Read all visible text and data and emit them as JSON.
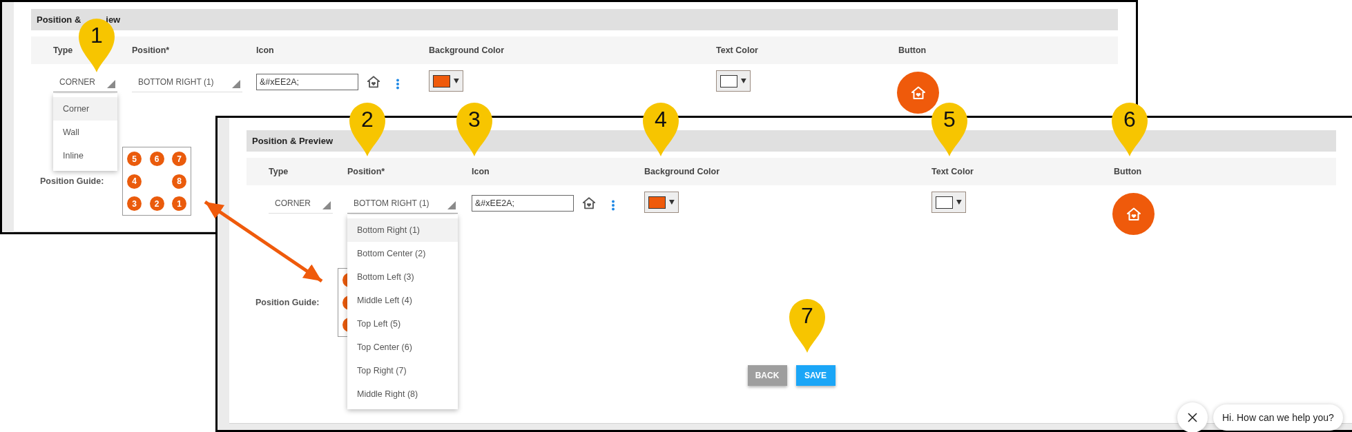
{
  "panels": [
    {
      "section_title": [
        "Position &",
        "iew"
      ],
      "columns": [
        "Type",
        "Position*",
        "Icon",
        "Background Color",
        "Text Color",
        "Button"
      ],
      "type_select": {
        "value": "CORNER",
        "expanded": true
      },
      "position_select": {
        "value": "BOTTOM RIGHT (1)",
        "expanded": false
      },
      "icon_field": {
        "value": "&#xEE2A;"
      },
      "background_color": {
        "color": "#ef5a0b"
      },
      "text_color": {
        "color": "#ffffff"
      },
      "button_preview": {
        "color": "#ef5a0b"
      },
      "dropdown_options": [
        {
          "label": "Corner",
          "selected": true
        },
        {
          "label": "Wall",
          "selected": false
        },
        {
          "label": "Inline",
          "selected": false
        }
      ],
      "position_guide": {
        "label": "Position Guide:",
        "rows": [
          [
            {
              "kind": "dot",
              "label": "5"
            },
            {
              "kind": "dot",
              "label": "6"
            },
            {
              "kind": "dot",
              "label": "7"
            }
          ],
          [
            {
              "kind": "dot",
              "label": "4"
            },
            {
              "kind": "gap"
            },
            {
              "kind": "dot",
              "label": "8"
            }
          ],
          [
            {
              "kind": "dot",
              "label": "3"
            },
            {
              "kind": "dot",
              "label": "2"
            },
            {
              "kind": "dot",
              "label": "1"
            }
          ]
        ]
      }
    },
    {
      "section_title": [
        "Position & Preview"
      ],
      "columns": [
        "Type",
        "Position*",
        "Icon",
        "Background Color",
        "Text Color",
        "Button"
      ],
      "type_select": {
        "value": "CORNER",
        "expanded": false
      },
      "position_select": {
        "value": "BOTTOM RIGHT (1)",
        "expanded": true
      },
      "icon_field": {
        "value": "&#xEE2A;"
      },
      "background_color": {
        "color": "#ef5a0b"
      },
      "text_color": {
        "color": "#ffffff"
      },
      "button_preview": {
        "color": "#ef5a0b"
      },
      "dropdown_options": [
        {
          "label": "Bottom Right (1)",
          "selected": true
        },
        {
          "label": "Bottom Center (2)",
          "selected": false
        },
        {
          "label": "Bottom Left (3)",
          "selected": false
        },
        {
          "label": "Middle Left (4)",
          "selected": false
        },
        {
          "label": "Top Left (5)",
          "selected": false
        },
        {
          "label": "Top Center (6)",
          "selected": false
        },
        {
          "label": "Top Right (7)",
          "selected": false
        },
        {
          "label": "Middle Right (8)",
          "selected": false
        }
      ],
      "position_guide": {
        "label": "Position Guide:",
        "rows": [
          [
            {
              "kind": "dot"
            }
          ],
          [
            {
              "kind": "dot"
            }
          ],
          [
            {
              "kind": "dot"
            }
          ]
        ]
      },
      "actions": [
        {
          "label": "BACK",
          "kind": "secondary"
        },
        {
          "label": "SAVE",
          "kind": "primary"
        }
      ]
    }
  ],
  "markers": [
    {
      "label": "1"
    },
    {
      "label": "2"
    },
    {
      "label": "3"
    },
    {
      "label": "4"
    },
    {
      "label": "5"
    },
    {
      "label": "6"
    },
    {
      "label": "7"
    }
  ],
  "chat": {
    "message": "Hi. How can we help you?"
  }
}
